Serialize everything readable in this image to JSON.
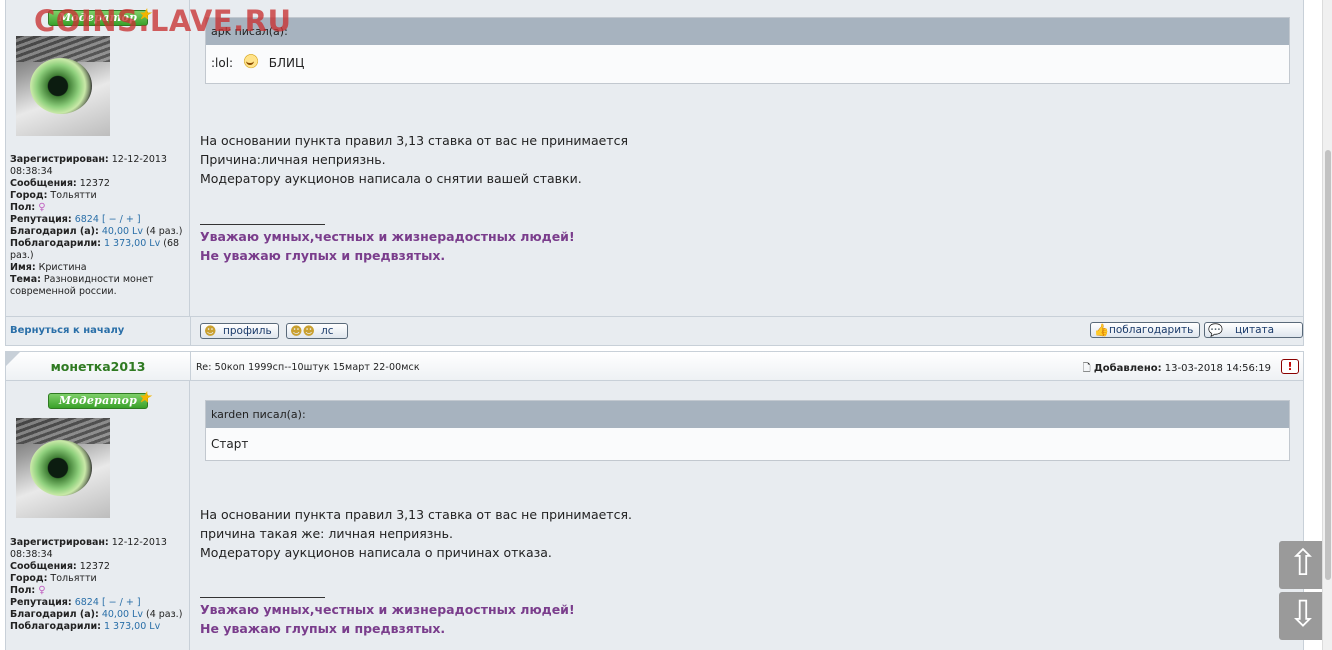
{
  "watermark": "COINS.LAVE.RU",
  "posts": [
    {
      "badge": "Модератор",
      "user": {
        "registered_label": "Зарегистрирован:",
        "registered_value": " 12-12-2013 08:38:34",
        "messages_label": "Сообщения:",
        "messages_value": " 12372",
        "city_label": "Город:",
        "city_value": " Тольятти",
        "sex_label": "Пол:",
        "reputation_label": "Репутация:",
        "reputation_value": "6824",
        "reputation_controls": "[ − / + ]",
        "thanked_label": "Благодарил (а):",
        "thanked_value": "40,00 Lv",
        "thanked_count": " (4 раз.)",
        "thanked_by_label": "Поблагодарили:",
        "thanked_by_value": "1 373,00 Lv",
        "thanked_by_count": " (68 раз.)",
        "name_label": "Имя:",
        "name_value": " Кристина",
        "topic_label": "Тема:",
        "topic_value": " Разновидности монет современной россии."
      },
      "quote": {
        "header": "apk писал(а):",
        "body_prefix": ":lol:",
        "body_text": "БЛИЦ"
      },
      "message": [
        "На основании пункта правил 3,13 ставка от вас не принимается",
        "Причина:личная неприязнь.",
        "Модератору аукционов написала о снятии вашей ставки."
      ],
      "signature": [
        "Уважаю умных,честных и жизнерадостных людей!",
        "Не уважаю глупых и предвзятых."
      ]
    },
    {
      "author": "монетка2013",
      "topic": "Re: 50коп 1999сп--10штук 15март 22-00мск",
      "added_label": "Добавлено:",
      "added_value": " 13-03-2018 14:56:19",
      "report": "!",
      "badge": "Модератор",
      "user": {
        "registered_label": "Зарегистрирован:",
        "registered_value": " 12-12-2013 08:38:34",
        "messages_label": "Сообщения:",
        "messages_value": " 12372",
        "city_label": "Город:",
        "city_value": " Тольятти",
        "sex_label": "Пол:",
        "reputation_label": "Репутация:",
        "reputation_value": "6824",
        "reputation_controls": "[ − / + ]",
        "thanked_label": "Благодарил (а):",
        "thanked_value": "40,00 Lv",
        "thanked_count": " (4 раз.)",
        "thanked_by_label": "Поблагодарили:",
        "thanked_by_value": "1 373,00 Lv"
      },
      "quote": {
        "header": "karden писал(а):",
        "body_text": "Старт"
      },
      "message": [
        "На основании пункта правил 3,13 ставка от вас не принимается.",
        "причина такая же: личная неприязнь.",
        "Модератору аукционов написала о причинах отказа."
      ],
      "signature": [
        "Уважаю умных,честных и жизнерадостных людей!",
        "Не уважаю глупых и предвзятых."
      ]
    }
  ],
  "actions": {
    "back_to_top": "Вернуться к началу",
    "profile": "профиль",
    "pm": "лс",
    "thank": "поблагодарить",
    "quote": "цитата"
  },
  "nav": {
    "up": "⇧",
    "down": "⇩"
  }
}
